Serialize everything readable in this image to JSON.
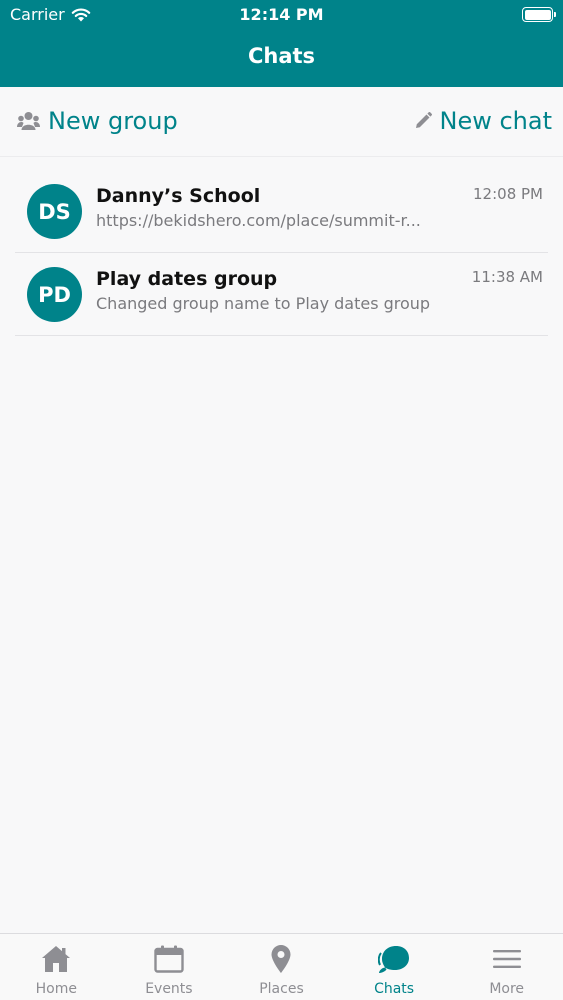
{
  "status_bar": {
    "carrier": "Carrier",
    "time": "12:14 PM"
  },
  "nav": {
    "title": "Chats"
  },
  "actions": {
    "new_group": "New group",
    "new_chat": "New chat"
  },
  "chats": [
    {
      "initials": "DS",
      "name": "Danny’s School",
      "preview": "https://bekidshero.com/place/summit-r...",
      "time": "12:08 PM"
    },
    {
      "initials": "PD",
      "name": "Play dates group",
      "preview": "Changed group name to Play dates group",
      "time": "11:38 AM"
    }
  ],
  "tabs": [
    {
      "label": "Home",
      "icon": "home-icon"
    },
    {
      "label": "Events",
      "icon": "calendar-icon"
    },
    {
      "label": "Places",
      "icon": "map-pin-icon"
    },
    {
      "label": "Chats",
      "icon": "chat-bubble-icon",
      "active": true
    },
    {
      "label": "More",
      "icon": "menu-icon"
    }
  ],
  "colors": {
    "brand": "#00838a",
    "tab_inactive": "#8e8e93"
  }
}
